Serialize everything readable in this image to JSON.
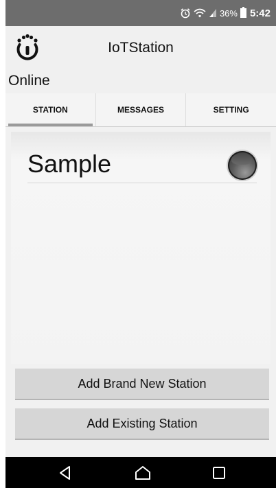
{
  "status_bar": {
    "icons": [
      "alarm-icon",
      "wifi-icon",
      "signal-icon",
      "battery-icon"
    ],
    "battery_percent": "36%",
    "time": "5:42"
  },
  "header": {
    "logo_icon": "iotstation-logo-icon",
    "title": "IoTStation",
    "connection_status": "Online"
  },
  "tabs": [
    {
      "label": "STATION",
      "active": true
    },
    {
      "label": "MESSAGES",
      "active": false
    },
    {
      "label": "SETTING",
      "active": false
    }
  ],
  "stations": [
    {
      "name": "Sample",
      "status_icon": "status-led-icon"
    }
  ],
  "actions": {
    "add_new_label": "Add Brand New Station",
    "add_existing_label": "Add Existing Station"
  },
  "nav_bar": {
    "icons": [
      "back-icon",
      "home-icon",
      "recent-apps-icon"
    ]
  },
  "colors": {
    "status_bar_bg": "#6d6d6d",
    "app_bg": "#f1f1f1",
    "button_bg": "#d6d6d6",
    "tab_indicator": "#9a9a9a",
    "nav_bar_bg": "#000000"
  }
}
